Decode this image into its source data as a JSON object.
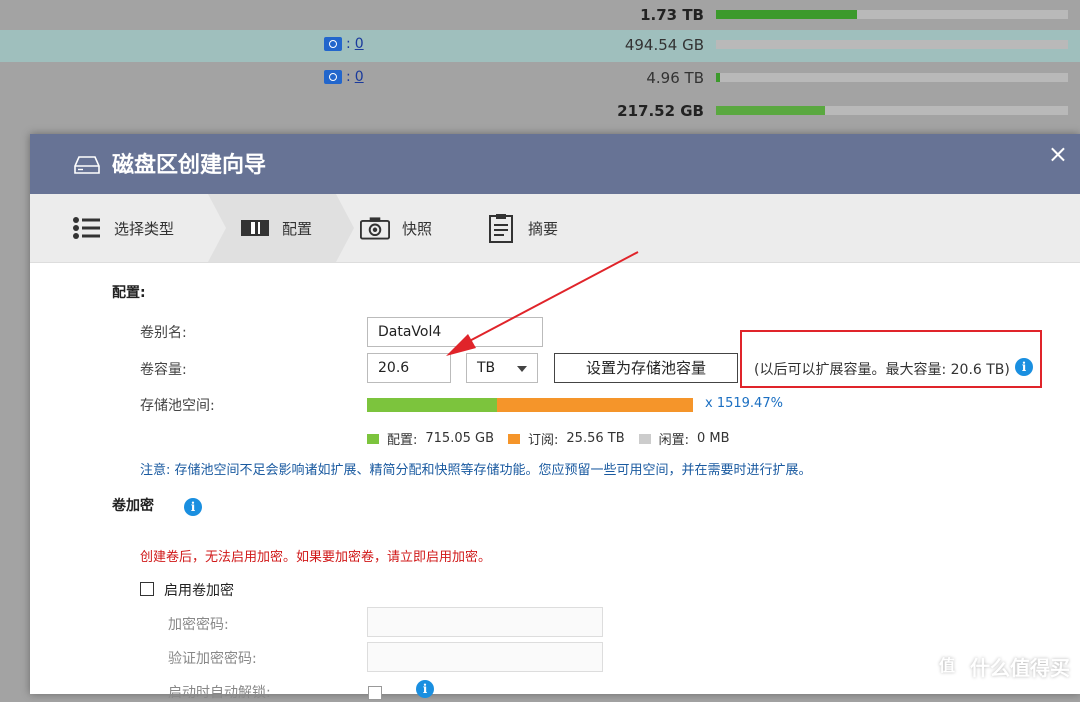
{
  "background_table": {
    "rows": [
      {
        "link": "",
        "size": "1.73 TB",
        "bold": true,
        "fill_pct": 40
      },
      {
        "link": "0",
        "size": "494.54 GB",
        "bold": false,
        "fill_pct": 0
      },
      {
        "link": "0",
        "size": "4.96 TB",
        "bold": false,
        "fill_pct": 1
      },
      {
        "link": "",
        "size": "217.52 GB",
        "bold": true,
        "fill_pct": 31
      }
    ],
    "colon": ":"
  },
  "dialog": {
    "title": "磁盘区创建向导",
    "close": "×",
    "steps": [
      "选择类型",
      "配置",
      "快照",
      "摘要"
    ],
    "config_title": "配置:",
    "alias_label": "卷别名:",
    "alias_value": "DataVol4",
    "capacity_label": "卷容量:",
    "capacity_value": "20.6",
    "unit": "TB",
    "set_max_button": "设置为存储池容量",
    "max_capacity_text": "(以后可以扩展容量。最大容量: 20.6 TB)",
    "pool_label": "存储池空间:",
    "pool_pct": "x 1519.47%",
    "legend": [
      {
        "label": "配置:",
        "value": "715.05 GB",
        "color": "#7cc43d"
      },
      {
        "label": "订阅:",
        "value": "25.56 TB",
        "color": "#f5952a"
      },
      {
        "label": "闲置:",
        "value": "0 MB",
        "color": "#cccccc"
      }
    ],
    "note": "注意: 存储池空间不足会影响诸如扩展、精简分配和快照等存储功能。您应预留一些可用空间，并在需要时进行扩展。",
    "encrypt_title": "卷加密",
    "encrypt_warning": "创建卷后，无法启用加密。如果要加密卷，请立即启用加密。",
    "enable_encrypt": "启用卷加密",
    "enc_password": "加密密码:",
    "verify_password": "验证加密密码:",
    "auto_unlock": "启动时自动解锁:"
  },
  "watermark": {
    "glyph": "值",
    "text": "什么值得买"
  }
}
